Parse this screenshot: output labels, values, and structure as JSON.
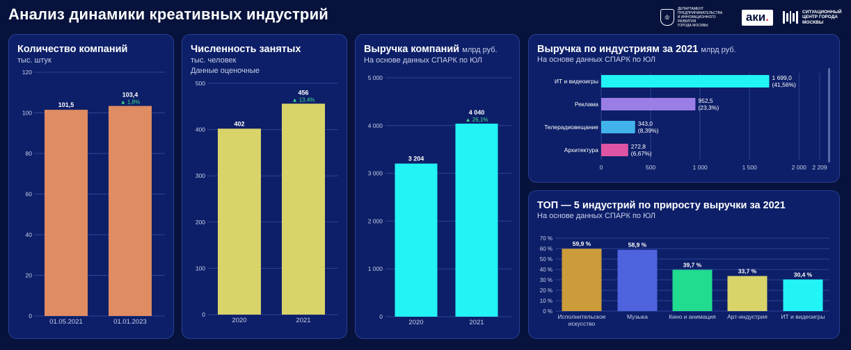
{
  "page_title": "Анализ динамики креативных индустрий",
  "logos": {
    "dept_text": "ДЕПАРТАМЕНТ\nПРЕДПРИНИМАТЕЛЬСТВА\nИ ИННОВАЦИОННОГО РАЗВИТИЯ\nГОРОДА МОСКВЫ",
    "aki": "аки",
    "aki_dot": ".",
    "sc_text": "СИТУАЦИОННЫЙ\nЦЕНТР ГОРОДА\nМОСКВЫ"
  },
  "colors": {
    "background": "#07133d",
    "panel": "#0d1f68",
    "companies_bar": "#df8c62",
    "employed_bar": "#d8d46a",
    "revenue_bar": "#22f3f5",
    "growth_green": "#3fe08c"
  },
  "panels": {
    "companies": {
      "title": "Количество компаний",
      "subtitle": "тыс. штук"
    },
    "employed": {
      "title": "Численность занятых",
      "subtitle": "тыс. человек",
      "subtitle2": "Данные оценочные"
    },
    "revenue": {
      "title": "Выручка компаний",
      "unit": "млрд руб.",
      "subtitle": "На основе данных СПАРК по ЮЛ"
    },
    "industries": {
      "title": "Выручка по индустриям за 2021",
      "unit": "млрд руб.",
      "subtitle": "На основе данных СПАРК по ЮЛ"
    },
    "top5": {
      "title": "ТОП — 5 индустрий по приросту выручки за 2021",
      "subtitle": "На основе данных СПАРК по ЮЛ"
    }
  },
  "chart_data": [
    {
      "id": "companies",
      "type": "bar",
      "categories": [
        "01.05.2021",
        "01.01.2023"
      ],
      "values": [
        101.5,
        103.4
      ],
      "labels": [
        "101,5",
        "103,4"
      ],
      "growth": [
        "",
        "▲ 1,8%"
      ],
      "ylim": [
        0,
        120
      ],
      "yticks": [
        "0",
        "20",
        "40",
        "60",
        "80",
        "100",
        "120"
      ],
      "ytick_values": [
        0,
        20,
        40,
        60,
        80,
        100,
        120
      ],
      "color": "#df8c62"
    },
    {
      "id": "employed",
      "type": "bar",
      "categories": [
        "2020",
        "2021"
      ],
      "values": [
        402,
        456
      ],
      "labels": [
        "402",
        "456"
      ],
      "growth": [
        "",
        "▲ 13,4%"
      ],
      "ylim": [
        0,
        500
      ],
      "yticks": [
        "0",
        "100",
        "200",
        "300",
        "400",
        "500"
      ],
      "ytick_values": [
        0,
        100,
        200,
        300,
        400,
        500
      ],
      "color": "#d8d46a"
    },
    {
      "id": "revenue",
      "type": "bar",
      "categories": [
        "2020",
        "2021"
      ],
      "values": [
        3204,
        4040
      ],
      "labels": [
        "3 204",
        "4 040"
      ],
      "growth": [
        "",
        "▲ 26,1%"
      ],
      "ylim": [
        0,
        5000
      ],
      "yticks": [
        "0",
        "1 000",
        "2 000",
        "3 000",
        "4 000",
        "5 000"
      ],
      "ytick_values": [
        0,
        1000,
        2000,
        3000,
        4000,
        5000
      ],
      "color": "#22f3f5"
    },
    {
      "id": "industries",
      "type": "bar",
      "orientation": "horizontal",
      "categories": [
        "ИТ и видеоигры",
        "Реклама",
        "Телерадиовещание",
        "Архитектура"
      ],
      "values": [
        1699.0,
        952.5,
        343.0,
        272.8
      ],
      "labels": [
        "1 699,0",
        "952,5",
        "343,0",
        "272,8"
      ],
      "shares": [
        "(41,56%)",
        "(23,3%)",
        "(8,39%)",
        "(6,67%)"
      ],
      "colors": [
        "#22f3f5",
        "#9b7de6",
        "#41b3ea",
        "#e055a3"
      ],
      "xlim": [
        0,
        2209
      ],
      "xticks": [
        "0",
        "500",
        "1 000",
        "1 500",
        "2 000",
        "2 209"
      ],
      "xtick_values": [
        0,
        500,
        1000,
        1500,
        2000,
        2209
      ]
    },
    {
      "id": "top5",
      "type": "bar",
      "categories": [
        "Исполнительское искусство",
        "Музыка",
        "Кино и анимация",
        "Арт-индустрия",
        "ИТ и видеоигры"
      ],
      "values": [
        59.9,
        58.9,
        39.7,
        33.7,
        30.4
      ],
      "labels": [
        "59,9 %",
        "58,9 %",
        "39,7 %",
        "33,7 %",
        "30,4 %"
      ],
      "colors": [
        "#cc9c3a",
        "#4e63dd",
        "#21db8e",
        "#d8d46a",
        "#22f3f5"
      ],
      "ylim": [
        0,
        70
      ],
      "yticks": [
        "0 %",
        "10 %",
        "20 %",
        "30 %",
        "40 %",
        "50 %",
        "60 %",
        "70 %"
      ],
      "ytick_values": [
        0,
        10,
        20,
        30,
        40,
        50,
        60,
        70
      ]
    }
  ]
}
